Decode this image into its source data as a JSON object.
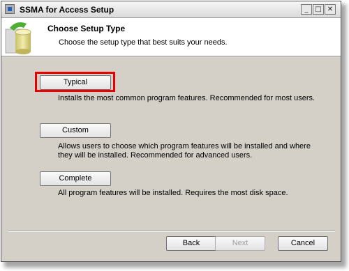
{
  "window": {
    "title": "SSMA for Access Setup",
    "controls": {
      "minimize_icon": "minimize-icon",
      "maximize_icon": "maximize-icon",
      "close_icon": "close-icon"
    }
  },
  "header": {
    "title": "Choose Setup Type",
    "subtitle": "Choose the setup type that best suits your needs."
  },
  "options": [
    {
      "label": "Typical",
      "description": "Installs the most common program features. Recommended for most users.",
      "highlighted": true
    },
    {
      "label": "Custom",
      "description_lines": [
        "Allows users to choose which program features will be installed and where",
        "they will be installed. Recommended for advanced users."
      ]
    },
    {
      "label": "Complete",
      "description": "All program features will be installed. Requires the most disk space."
    }
  ],
  "footer": {
    "back_label": "Back",
    "next_label": "Next",
    "next_enabled": false,
    "cancel_label": "Cancel"
  },
  "colors": {
    "highlight_border": "#e60000",
    "dialog_background": "#d4d0c8"
  }
}
